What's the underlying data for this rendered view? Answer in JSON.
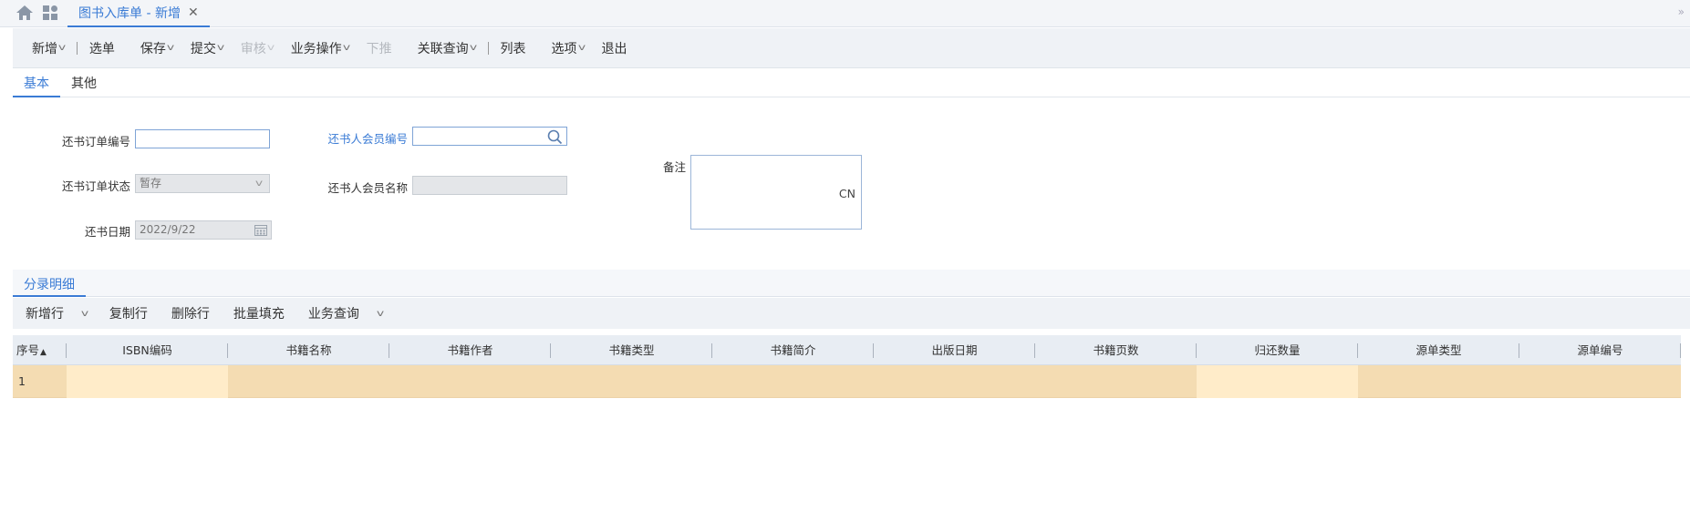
{
  "tab": {
    "title": "图书入库单 - 新增",
    "close_glyph": "✕"
  },
  "toolbar": {
    "new": "新增",
    "select": "选单",
    "save": "保存",
    "submit": "提交",
    "audit": "审核",
    "business_ops": "业务操作",
    "push_down": "下推",
    "related_query": "关联查询",
    "list": "列表",
    "options": "选项",
    "exit": "退出"
  },
  "main_tabs": {
    "basic": "基本",
    "other": "其他"
  },
  "form": {
    "order_no_label": "还书订单编号",
    "order_no_value": "",
    "order_status_label": "还书订单状态",
    "order_status_value": "暂存",
    "return_date_label": "还书日期",
    "return_date_value": "2022/9/22",
    "member_no_label": "还书人会员编号",
    "member_no_value": "",
    "member_name_label": "还书人会员名称",
    "member_name_value": "",
    "remark_label": "备注",
    "remark_lang": "CN"
  },
  "detail": {
    "tab": "分录明细",
    "toolbar": {
      "add_row": "新增行",
      "copy_row": "复制行",
      "delete_row": "删除行",
      "batch_fill": "批量填充",
      "business_query": "业务查询"
    },
    "columns": [
      "序号",
      "ISBN编码",
      "书籍名称",
      "书籍作者",
      "书籍类型",
      "书籍简介",
      "出版日期",
      "书籍页数",
      "归还数量",
      "源单类型",
      "源单编号"
    ],
    "rows": [
      {
        "seq": "1"
      }
    ]
  },
  "icons": [
    "home-icon",
    "apps-icon",
    "close-icon",
    "chevron-down-icon",
    "search-icon",
    "calendar-icon",
    "sort-up-icon",
    "double-chevron-icon"
  ],
  "colors": {
    "accent": "#3a7bd5",
    "row_highlight": "#f4dcb2",
    "row_light": "#ffecc9"
  }
}
